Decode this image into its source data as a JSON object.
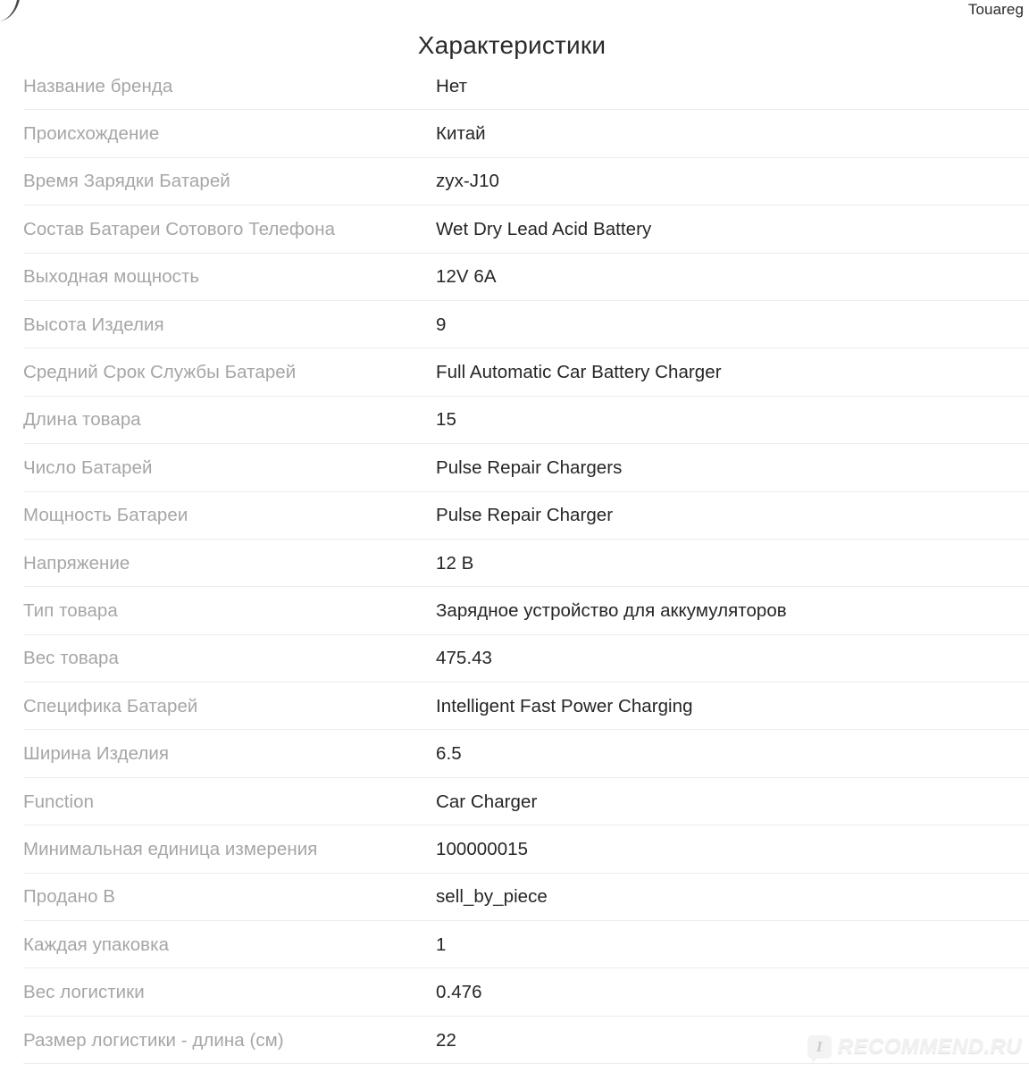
{
  "header": {
    "title": "Характеристики",
    "corner_label": "Touareg"
  },
  "table": {
    "rows": [
      {
        "label": "Название бренда",
        "value": "Нет"
      },
      {
        "label": "Происхождение",
        "value": "Китай"
      },
      {
        "label": "Время Зарядки Батарей",
        "value": "zyx-J10"
      },
      {
        "label": "Состав Батареи Сотового Телефона",
        "value": "Wet Dry Lead Acid Battery"
      },
      {
        "label": "Выходная мощность",
        "value": "12V 6A"
      },
      {
        "label": "Высота Изделия",
        "value": "9"
      },
      {
        "label": "Средний Срок Службы Батарей",
        "value": "Full Automatic Car Battery Charger"
      },
      {
        "label": "Длина товара",
        "value": "15"
      },
      {
        "label": "Число Батарей",
        "value": "Pulse Repair Chargers"
      },
      {
        "label": "Мощность Батареи",
        "value": "Pulse Repair Charger"
      },
      {
        "label": "Напряжение",
        "value": "12 В"
      },
      {
        "label": "Тип товара",
        "value": "Зарядное устройство для аккумуляторов"
      },
      {
        "label": "Вес товара",
        "value": "475.43"
      },
      {
        "label": "Специфика Батарей",
        "value": "Intelligent Fast Power Charging"
      },
      {
        "label": "Ширина Изделия",
        "value": "6.5"
      },
      {
        "label": "Function",
        "value": "Car Charger"
      },
      {
        "label": "Минимальная единица измерения",
        "value": "100000015"
      },
      {
        "label": "Продано В",
        "value": "sell_by_piece"
      },
      {
        "label": "Каждая упаковка",
        "value": "1"
      },
      {
        "label": "Вес логистики",
        "value": "0.476"
      },
      {
        "label": "Размер логистики - длина (см)",
        "value": "22"
      }
    ]
  },
  "watermark": {
    "badge_letter": "I",
    "text": "RECOMMEND.RU"
  },
  "colors": {
    "label_text": "#a6a6a6",
    "value_text": "#262626",
    "divider": "#ececec",
    "background": "#ffffff"
  }
}
